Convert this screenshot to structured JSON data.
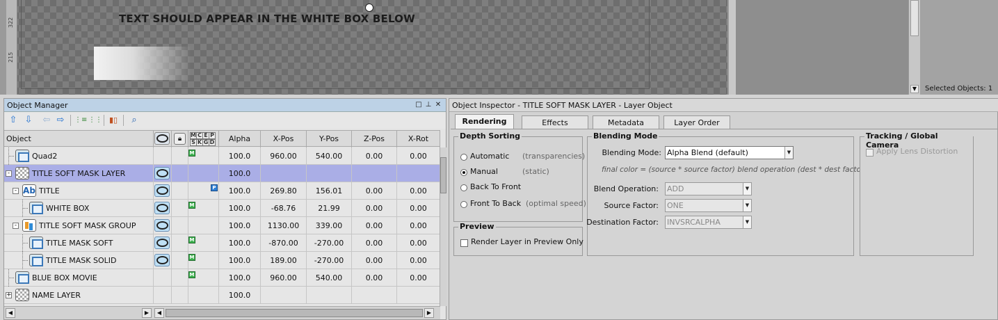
{
  "viewport": {
    "ruler_labels": [
      "322",
      "215"
    ],
    "preview_text": "TEXT SHOULD APPEAR IN THE WHITE BOX BELOW",
    "selected_objects": "Selected Objects: 1"
  },
  "object_manager": {
    "title": "Object Manager",
    "window_buttons": [
      "□",
      "⊥",
      "✕"
    ],
    "columns": [
      "Object",
      "Alpha",
      "X-Pos",
      "Y-Pos",
      "Z-Pos",
      "X-Rot"
    ],
    "flag_letters_top": [
      "M",
      "C",
      "E",
      "P"
    ],
    "flag_letters_bottom": [
      "S",
      "K",
      "G",
      "D"
    ],
    "rows": [
      {
        "name": "Quad2",
        "icon": "quad-icon",
        "alpha": "100.0",
        "x": "960.00",
        "y": "540.00",
        "z": "0.00",
        "xrot": "0.00",
        "badge": "M"
      },
      {
        "name": "TITLE SOFT MASK LAYER",
        "icon": "layer-icon",
        "alpha": "100.0",
        "x": "",
        "y": "",
        "z": "",
        "xrot": "",
        "badge": ""
      },
      {
        "name": "TITLE",
        "icon": "text-icon",
        "alpha": "100.0",
        "x": "269.80",
        "y": "156.01",
        "z": "0.00",
        "xrot": "0.00",
        "badge": "P"
      },
      {
        "name": "WHITE BOX",
        "icon": "quad-icon",
        "alpha": "100.0",
        "x": "-68.76",
        "y": "21.99",
        "z": "0.00",
        "xrot": "0.00",
        "badge": "M"
      },
      {
        "name": "TITLE SOFT MASK GROUP",
        "icon": "group-icon",
        "alpha": "100.0",
        "x": "1130.00",
        "y": "339.00",
        "z": "0.00",
        "xrot": "0.00",
        "badge": ""
      },
      {
        "name": "TITLE MASK SOFT",
        "icon": "quad-icon",
        "alpha": "100.0",
        "x": "-870.00",
        "y": "-270.00",
        "z": "0.00",
        "xrot": "0.00",
        "badge": "M"
      },
      {
        "name": "TITLE MASK SOLID",
        "icon": "quad-icon",
        "alpha": "100.0",
        "x": "189.00",
        "y": "-270.00",
        "z": "0.00",
        "xrot": "0.00",
        "badge": "M"
      },
      {
        "name": "BLUE BOX MOVIE",
        "icon": "quad-icon",
        "alpha": "100.0",
        "x": "960.00",
        "y": "540.00",
        "z": "0.00",
        "xrot": "0.00",
        "badge": "M"
      },
      {
        "name": "NAME LAYER",
        "icon": "layer-icon",
        "alpha": "100.0",
        "x": "",
        "y": "",
        "z": "",
        "xrot": "",
        "badge": ""
      }
    ]
  },
  "object_inspector": {
    "title": "Object Inspector - TITLE SOFT MASK LAYER - Layer Object",
    "tabs": [
      "Rendering",
      "Effects",
      "Metadata",
      "Layer Order"
    ],
    "depth_sorting": {
      "title": "Depth Sorting",
      "options": [
        {
          "label": "Automatic",
          "hint": "(transparencies)",
          "selected": false
        },
        {
          "label": "Manual",
          "hint": "(static)",
          "selected": true
        },
        {
          "label": "Back To Front",
          "hint": "",
          "selected": false
        },
        {
          "label": "Front To Back",
          "hint": "(optimal speed)",
          "selected": false
        }
      ]
    },
    "preview": {
      "title": "Preview",
      "render_layer_label": "Render Layer in Preview Only"
    },
    "blending": {
      "title": "Blending Mode",
      "mode_label": "Blending Mode:",
      "mode_value": "Alpha Blend (default)",
      "formula": "final color = (source * source factor) blend operation (dest * dest factor)",
      "blend_op_label": "Blend Operation:",
      "blend_op_value": "ADD",
      "source_label": "Source Factor:",
      "source_value": "ONE",
      "dest_label": "Destination Factor:",
      "dest_value": "INVSRCALPHA"
    },
    "tracking": {
      "title": "Tracking / Global Camera",
      "lens_label": "Apply Lens Distortion"
    }
  }
}
